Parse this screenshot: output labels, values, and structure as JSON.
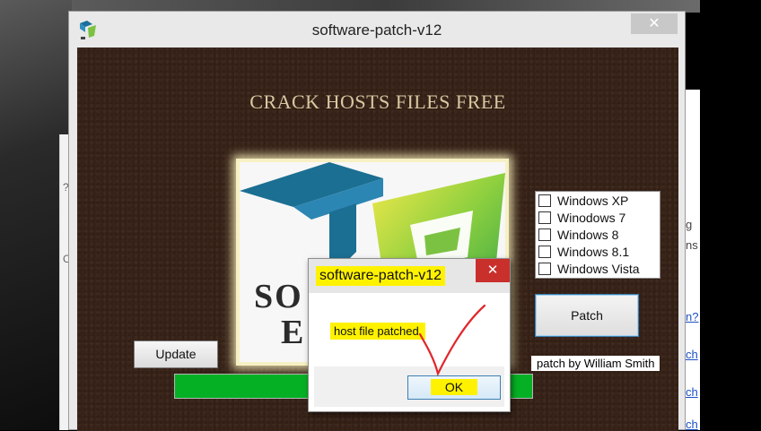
{
  "window": {
    "title": "software-patch-v12",
    "close_symbol": "✕"
  },
  "banner": "CRACK HOSTS FILES FREE",
  "logo": {
    "text_line1": "SO",
    "text_line2": "E",
    "icon": "software-patch-logo-icon"
  },
  "os_options": [
    {
      "label": "Windows XP",
      "checked": false
    },
    {
      "label": "Winodows 7",
      "checked": false
    },
    {
      "label": "Windows 8",
      "checked": false
    },
    {
      "label": "Windows 8.1",
      "checked": false
    },
    {
      "label": "Windows Vista",
      "checked": false
    }
  ],
  "buttons": {
    "patch": "Patch",
    "update": "Update"
  },
  "credit": "patch by William Smith",
  "progress": {
    "value": 1.0,
    "color": "#06b025"
  },
  "dialog": {
    "title": "software-patch-v12",
    "close_symbol": "✕",
    "message": "host file patched.",
    "ok": "OK"
  },
  "highlight_color": "#fff200",
  "annotation": {
    "icon": "red-checkmark-icon",
    "color": "#e0262a"
  },
  "background_fragments": [
    "g",
    "ns",
    "n?",
    "ch",
    "ch",
    "ch"
  ],
  "background_extra": {
    "left_char": "?",
    "left_char2": "C"
  }
}
